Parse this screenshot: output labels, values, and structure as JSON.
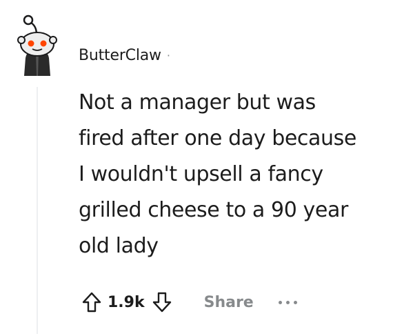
{
  "comment": {
    "author": "ButterClaw",
    "separator": "·",
    "body": "Not a manager but was\nfired after one day because\nI wouldn't upsell a fancy\ngrilled cheese to a 90 year\nold lady",
    "score": "1.9k",
    "share_label": "Share"
  },
  "icons": {
    "avatar": "snoo-avatar-icon",
    "upvote": "upvote-arrow-icon",
    "downvote": "downvote-arrow-icon",
    "more": "more-options-icon"
  },
  "colors": {
    "text": "#1c1c1c",
    "muted": "#878a8c",
    "snoo_eye": "#ff4500",
    "thread_line": "#edeff1"
  }
}
